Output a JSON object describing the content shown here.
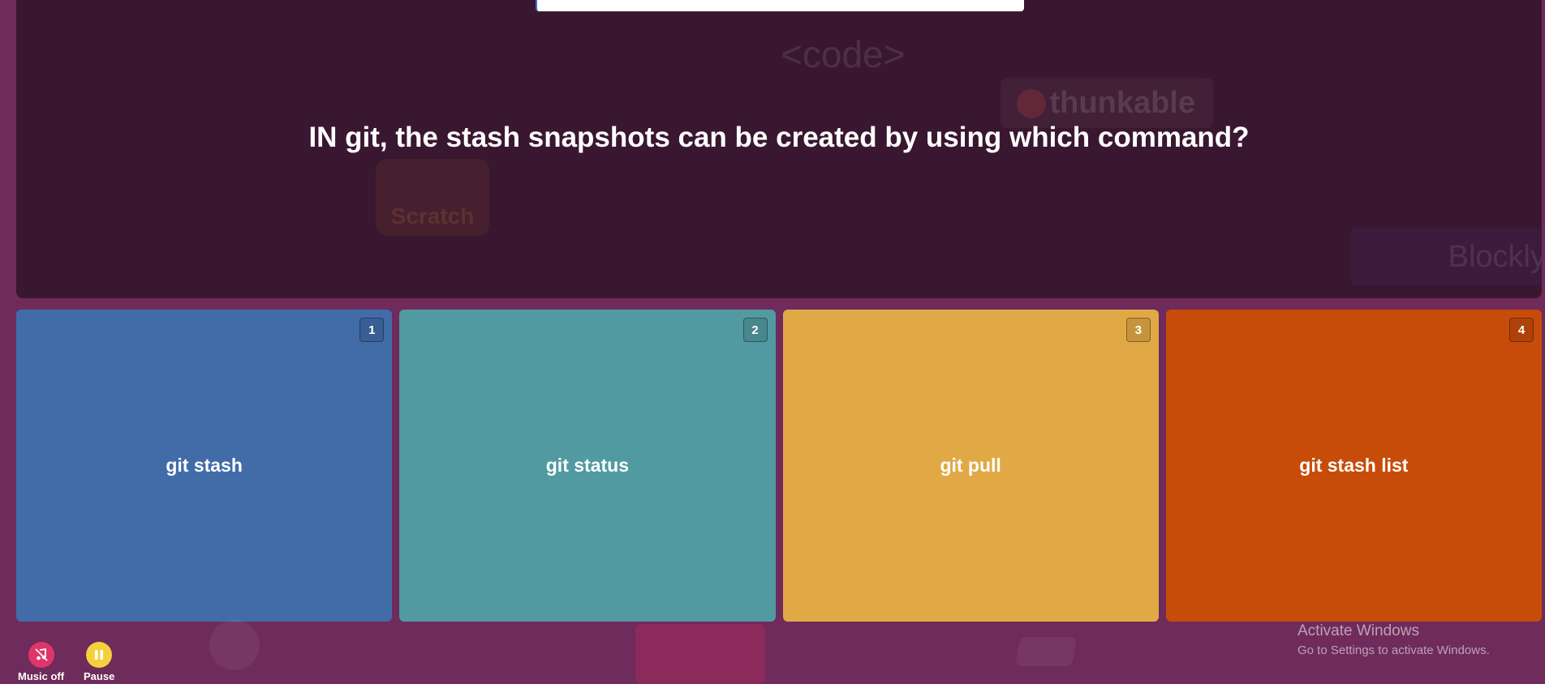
{
  "question": {
    "text": "IN git, the stash snapshots can be created by using which command?"
  },
  "background_decorations": {
    "code_tag": "<code>",
    "thunkable": "thunkable",
    "blockly": "Blockly",
    "scratch": "Scratch"
  },
  "answers": [
    {
      "number": "1",
      "text": "git stash",
      "color": "#416ca8"
    },
    {
      "number": "2",
      "text": "git status",
      "color": "#519aa1"
    },
    {
      "number": "3",
      "text": "git pull",
      "color": "#e1a946"
    },
    {
      "number": "4",
      "text": "git stash list",
      "color": "#c74c0a"
    }
  ],
  "controls": {
    "music_label": "Music off",
    "music_color": "#e0356a",
    "pause_label": "Pause",
    "pause_color": "#f4d03f"
  },
  "watermark": {
    "title": "Activate Windows",
    "subtitle": "Go to Settings to activate Windows."
  }
}
